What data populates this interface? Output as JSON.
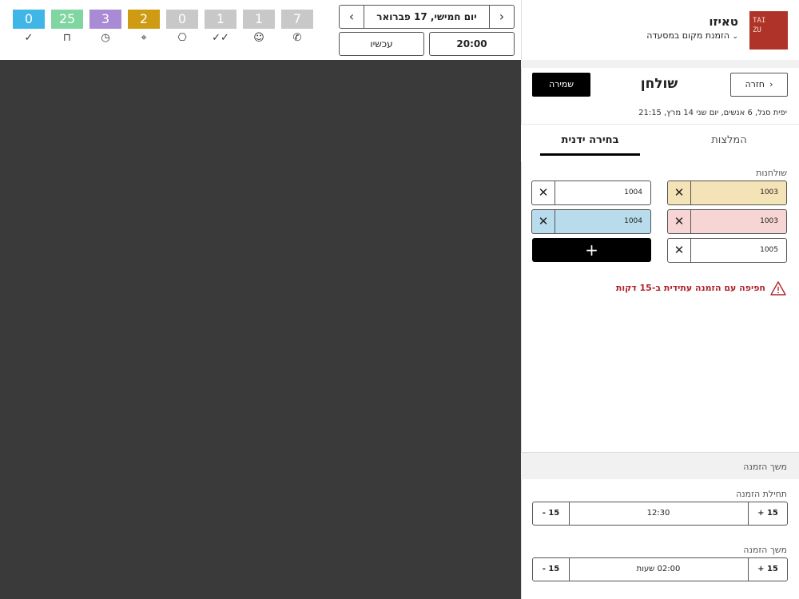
{
  "toolbar": {
    "stats": [
      {
        "value": "0",
        "color": "#40b6e6",
        "icon": "check-icon",
        "glyph": "✓"
      },
      {
        "value": "25",
        "color": "#7fd6a0",
        "icon": "table-icon",
        "glyph": "⊓"
      },
      {
        "value": "3",
        "color": "#a98ad4",
        "icon": "clock-icon",
        "glyph": "◷"
      },
      {
        "value": "2",
        "color": "#cf9b12",
        "icon": "location-pin-icon",
        "glyph": "⌖"
      },
      {
        "value": "0",
        "color": "#c8c8c8",
        "icon": "gift-icon",
        "glyph": "⎔"
      },
      {
        "value": "1",
        "color": "#c8c8c8",
        "icon": "double-check-icon",
        "glyph": "✓✓"
      },
      {
        "value": "1",
        "color": "#c8c8c8",
        "icon": "smiley-icon",
        "glyph": "☺"
      },
      {
        "value": "7",
        "color": "#c8c8c8",
        "icon": "phone-icon",
        "glyph": "✆"
      }
    ],
    "date_label": "יום חמישי, 17 פברואר",
    "now_label": "עכשיו",
    "time_label": "20:00"
  },
  "restaurant": {
    "name": "טאיזו",
    "subtitle": "הזמנת מקום במסעדה",
    "logo_text": "TAI\nZU"
  },
  "header": {
    "title": "שולחן",
    "save_label": "שמירה",
    "back_label": "חזרה",
    "reservation_info": "יפית סגל, 6 אנשים, יום שני 14 מרץ, 21:15"
  },
  "tabs": {
    "manual": "בחירה ידנית",
    "recommendations": "המלצות"
  },
  "tables": {
    "label": "שולחנות",
    "items": [
      {
        "value": "1003",
        "color": "#f3e3b6"
      },
      {
        "value": "1004",
        "color": "#ffffff"
      },
      {
        "value": "1003",
        "color": "#f7d5d5"
      },
      {
        "value": "1004",
        "color": "#b8dcec"
      },
      {
        "value": "1005",
        "color": "#ffffff"
      }
    ]
  },
  "warning": "חפיפה עם הזמנה עתידית ב-15 דקות",
  "duration_section": {
    "title": "משך הזמנה",
    "start": {
      "label": "תחילת הזמנה",
      "value": "12:30",
      "plus": "+ 15",
      "minus": "- 15"
    },
    "length": {
      "label": "משך הזמנה",
      "value": "02:00 שעות",
      "plus": "+ 15",
      "minus": "- 15"
    }
  }
}
